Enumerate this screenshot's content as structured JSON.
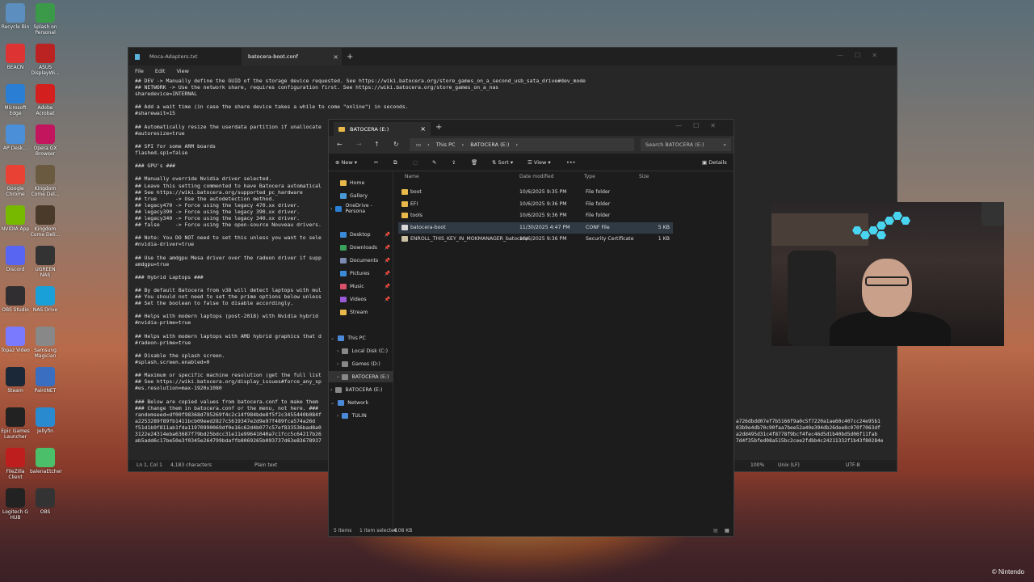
{
  "desktop": {
    "icons": [
      {
        "label": "Recycle Bin",
        "color": "#5c8fbf"
      },
      {
        "label": "Splash on Personal",
        "color": "#3b9a4a"
      },
      {
        "label": "BEACN",
        "color": "#d33"
      },
      {
        "label": "ASUS DisplayWi...",
        "color": "#b22"
      },
      {
        "label": "Microsoft Edge",
        "color": "#2a7fd4"
      },
      {
        "label": "Adobe Acrobat",
        "color": "#d41f1f"
      },
      {
        "label": "AP Desk...",
        "color": "#4a8fd8"
      },
      {
        "label": "Opera GX Browser",
        "color": "#c3155e"
      },
      {
        "label": "Google Chrome",
        "color": "#e94235"
      },
      {
        "label": "Kingdom Come Del...",
        "color": "#6a5a40"
      },
      {
        "label": "NVIDIA App",
        "color": "#76b900"
      },
      {
        "label": "Kingdom Come Deli...",
        "color": "#4a3a2a"
      },
      {
        "label": "Discord",
        "color": "#5865f2"
      },
      {
        "label": "UGREEN NAS",
        "color": "#333"
      },
      {
        "label": "OBS Studio",
        "color": "#302e31"
      },
      {
        "label": "NAS Drive",
        "color": "#1aa0d8"
      },
      {
        "label": "Topaz Video",
        "color": "#7a7aff"
      },
      {
        "label": "Samsung Magician",
        "color": "#888"
      },
      {
        "label": "Steam",
        "color": "#1b2838"
      },
      {
        "label": "PaintNET",
        "color": "#3a6ec0"
      },
      {
        "label": "Epic Games Launcher",
        "color": "#222"
      },
      {
        "label": "Jellyfin",
        "color": "#2a8ad0"
      },
      {
        "label": "FileZilla Client",
        "color": "#bf1e1e"
      },
      {
        "label": "balenaEtcher",
        "color": "#4cbf6a"
      },
      {
        "label": "Logitech G HUB",
        "color": "#222"
      },
      {
        "label": "OBS",
        "color": "#333"
      }
    ],
    "watermark": "© Nintendo"
  },
  "notepad": {
    "tabs": [
      {
        "label": "Moca-Adapters.txt"
      },
      {
        "label": "batocera-boot.conf"
      }
    ],
    "menu": [
      "File",
      "Edit",
      "View"
    ],
    "lines": [
      "## DEV -> Manually define the GUID of the storage device requested. See https://wiki.batocera.org/store_games_on_a_second_usb_sata_drive#dev_mode",
      "## NETWORK -> Use the network share, requires configuration first. See https://wiki.batocera.org/store_games_on_a_nas",
      "sharedevice=INTERNAL",
      "",
      "## Add a wait time (in case the share device takes a while to come \"online\") in seconds.",
      "#sharewait=15",
      "",
      "## Automatically resize the userdata partition if unallocate",
      "#autoresize=true",
      "",
      "## SPI for some ARM boards",
      "flashed.spi=false",
      "",
      "### GPU's ###",
      "",
      "## Manually override Nvidia driver selected.",
      "## Leave this setting commented to have Batocera automatical",
      "## See https://wiki.batocera.org/supported_pc_hardware",
      "## true      -> Use the autodetection method.",
      "## legacy470 -> Force using the legacy 470.xx driver.",
      "## legacy390 -> Force using the legacy 390.xx driver.",
      "## legacy340 -> Force using the legacy 340.xx driver.",
      "## false     -> Force using the open-source Nouveau drivers.",
      "",
      "## Note: You DO NOT need to set this unless you want to sele",
      "#nvidia-driver=true",
      "",
      "## Use the amdgpu Mesa driver over the radeon driver if supp",
      "amdgpu=true",
      "",
      "### Hybrid Laptops ###",
      "",
      "## By default Batocera from v38 will detect laptops with mul",
      "## You should not need to set the prime options below unless",
      "## Set the boolean to false to disable accordingly.",
      "",
      "## Helps with modern laptops (post-2018) with Nvidia hybrid",
      "#nvidia-prime=true",
      "",
      "## Helps with modern laptops with AMD hybrid graphics that d",
      "#radeon-prime=true",
      "",
      "## Disable the splash screen.",
      "#splash.screen.enabled=0",
      "",
      "## Maximum or specific machine resolution (get the full list",
      "## See https://wiki.batocera.org/display_issues#force_any_sp",
      "#es.resolution=max-1920x1080",
      "",
      "### Below are copied values from batocera.conf to make them",
      "### Change them in batocera.conf or the menu, not here. ###",
      "randomseed=df00f98368d795269f4c2c14f984bde8f5f2c3455440b084f",
      "a2253289f89fb1411bcb09eed2827c5619347e2d9e97f489fca574a26d",
      "f51d1b9f811ab1fda11970990069df0e16c62d4b077c57ef833536bad8a0",
      "3122e24314eba63687f79bd25bdcc31e11e99641040a7c1fcc5c64217b26",
      "ab5add6c17be50e3f0345e264799bdaffb8069265b093737d63e83678937"
    ],
    "right_lines": [
      "a726dbdd07ef7b5166f9a0c5f7220a1ae60c407cc24e95b1",
      "03b9e4db70c90faa7bee52a40e394db26dee8c070f7063df",
      "a2dd495d31c4f8778f9bcf4fec46d5d1b40bd5d06f11fab",
      "7d4f35bfed08a515bc2cee2fdbb4c24211332f1b43f80284e",
      ""
    ],
    "status": {
      "position": "Ln 1, Col 1",
      "chars": "4,183 characters",
      "format": "Plain text",
      "zoom": "100%",
      "eol": "Unix (LF)",
      "encoding": "UTF-8"
    }
  },
  "explorer": {
    "tab_label": "BATOCERA (E:)",
    "breadcrumbs": [
      "This PC",
      "BATOCERA (E:)"
    ],
    "search_placeholder": "Search BATOCERA (E:)",
    "toolbar": {
      "new": "New",
      "sort": "Sort",
      "view": "View",
      "more": "•••",
      "details": "Details"
    },
    "nav": [
      {
        "label": "Home",
        "color": "#e8b94a",
        "pin": false
      },
      {
        "label": "Gallery",
        "color": "#4a9ad8",
        "pin": false
      },
      {
        "label": "OneDrive - Persona",
        "color": "#2a7fd4",
        "pin": false
      },
      {
        "label": "Desktop",
        "color": "#3a8ad8",
        "pin": true
      },
      {
        "label": "Downloads",
        "color": "#3aa05a",
        "pin": true
      },
      {
        "label": "Documents",
        "color": "#7a8ab0",
        "pin": true
      },
      {
        "label": "Pictures",
        "color": "#3a8ad8",
        "pin": true
      },
      {
        "label": "Music",
        "color": "#d8506a",
        "pin": true
      },
      {
        "label": "Videos",
        "color": "#9a5ad8",
        "pin": true
      },
      {
        "label": "Stream",
        "color": "#e8b94a",
        "pin": false
      },
      {
        "label": "This PC",
        "color": "#4a8ad8",
        "pin": false
      },
      {
        "label": "Local Disk (C:)",
        "color": "#888",
        "pin": false
      },
      {
        "label": "Games (D:)",
        "color": "#888",
        "pin": false
      },
      {
        "label": "BATOCERA (E:)",
        "color": "#888",
        "pin": false
      },
      {
        "label": "BATOCERA (E:)",
        "color": "#888",
        "pin": false
      },
      {
        "label": "Network",
        "color": "#4a8ad8",
        "pin": false
      },
      {
        "label": "TULIN",
        "color": "#4a8ad8",
        "pin": false
      }
    ],
    "columns": [
      "Name",
      "Date modified",
      "Type",
      "Size"
    ],
    "files": [
      {
        "name": "boot",
        "date": "10/6/2025 9:35 PM",
        "type": "File folder",
        "size": "",
        "kind": "folder"
      },
      {
        "name": "EFI",
        "date": "10/6/2025 9:36 PM",
        "type": "File folder",
        "size": "",
        "kind": "folder"
      },
      {
        "name": "tools",
        "date": "10/6/2025 9:36 PM",
        "type": "File folder",
        "size": "",
        "kind": "folder"
      },
      {
        "name": "batocera-boot",
        "date": "11/30/2025 4:47 PM",
        "type": "CONF File",
        "size": "5 KB",
        "kind": "file"
      },
      {
        "name": "ENROLL_THIS_KEY_IN_MOKMANAGER_batocera",
        "date": "10/6/2025 9:36 PM",
        "type": "Security Certificate",
        "size": "1 KB",
        "kind": "cert"
      }
    ],
    "status": {
      "count": "5 items",
      "selected": "1 item selected",
      "size": "4.08 KB"
    }
  }
}
